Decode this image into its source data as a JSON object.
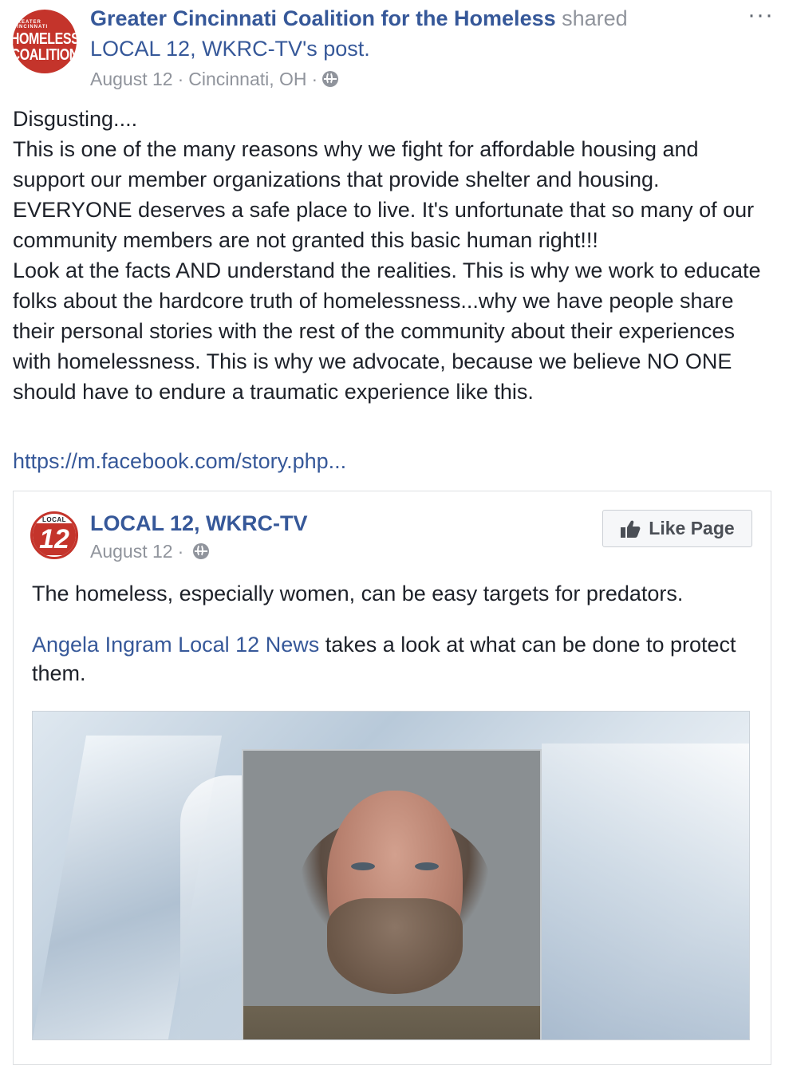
{
  "header": {
    "org_name": "Greater Cincinnati Coalition for the Homeless",
    "shared_word": "shared",
    "shared_page": "LOCAL 12, WKRC-TV",
    "shared_suffix": "'s post.",
    "date": "August 12",
    "separator": "·",
    "location": "Cincinnati, OH",
    "avatar_text": [
      "GREATER CINCINNATI",
      "HOMELESS",
      "COALITION"
    ],
    "more_icon": "···"
  },
  "post": {
    "text": "Disgusting....\nThis is one of the many reasons why we fight for affordable housing and support our member organizations that provide shelter and housing. EVERYONE deserves a safe place to live. It's unfortunate that so many of our community members are not granted this basic human right!!!\nLook at the facts AND understand the realities. This is why we work to educate folks about the hardcore truth of homelessness...why we have people share their personal stories with the rest of the community about their experiences with homelessness. This is why we advocate, because we believe NO ONE should have to endure a traumatic experience like this.",
    "link": "https://m.facebook.com/story.php..."
  },
  "shared_card": {
    "page_name": "LOCAL 12, WKRC-TV",
    "date": "August 12",
    "separator": "·",
    "avatar_text": [
      "LOCAL",
      "12"
    ],
    "like_button": "Like Page",
    "text1": "The homeless, especially women, can be easy targets for predators.",
    "mention": "Angela Ingram Local 12 News",
    "text2_rest": " takes a look at what can be done to protect them."
  },
  "colors": {
    "link": "#365899",
    "meta": "#90949c",
    "avatar_red": "#c4342b",
    "text": "#1d2129"
  }
}
